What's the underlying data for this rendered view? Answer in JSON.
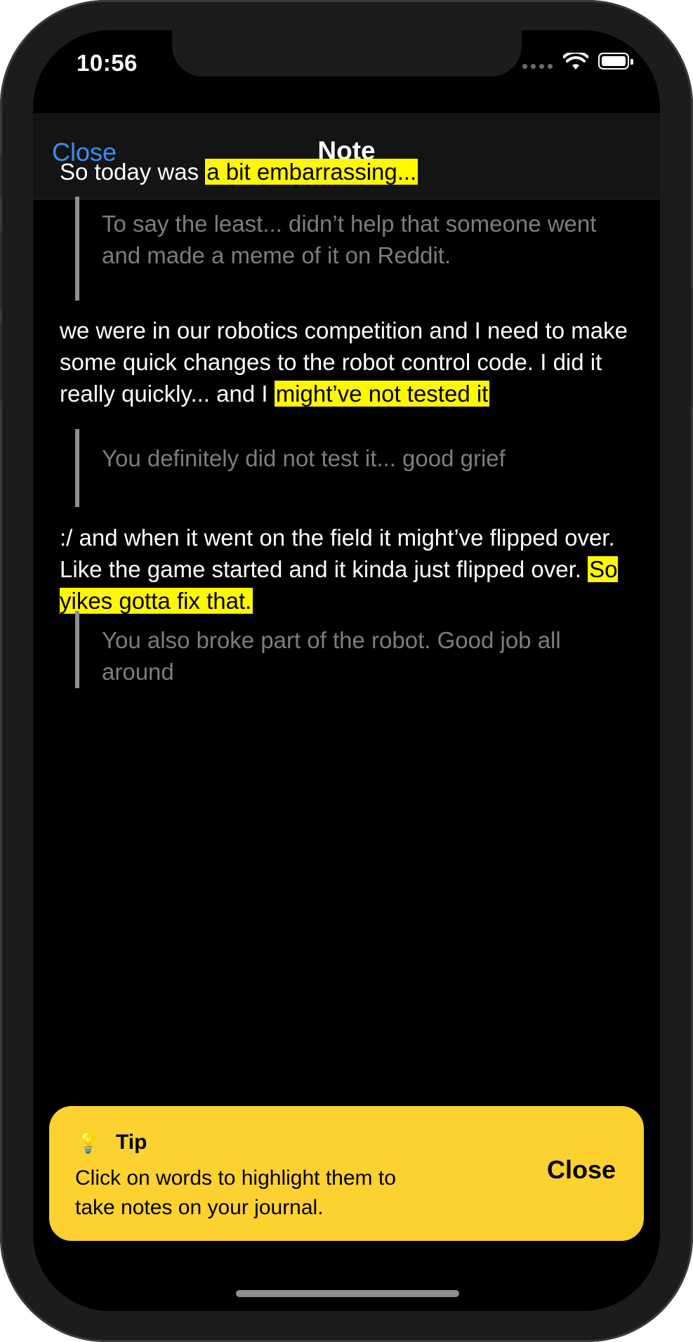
{
  "status_bar": {
    "time": "10:56"
  },
  "nav": {
    "close_label": "Close",
    "title": "Note"
  },
  "entries": [
    {
      "text": "So today was ",
      "highlight": "a bit embarrassing...",
      "text_after": "",
      "comment": "To say the least... didn’t help that someone went and made a meme of it on Reddit."
    },
    {
      "text": "we were in our robotics competition and I need to make some quick changes to the robot control code. I did it really quickly... and I ",
      "highlight": "might’ve not tested it",
      "text_after": "",
      "comment": "You definitely did not test it... good grief"
    },
    {
      "text": ":/ and when it went on the field it might’ve flipped over. Like the game started and it kinda just flipped over. ",
      "highlight": "So yikes gotta fix that.",
      "text_after": "",
      "comment": "You also broke part of the robot. Good job all around"
    }
  ],
  "tip": {
    "icon": "lightbulb-icon",
    "title": "Tip",
    "body": "Click on words to highlight them to take notes on your journal.",
    "close_label": "Close"
  },
  "colors": {
    "highlight": "#fdf700",
    "tip_background": "#fdd130",
    "link_blue": "#3a8ef0",
    "comment_text": "#7d7d7d"
  }
}
